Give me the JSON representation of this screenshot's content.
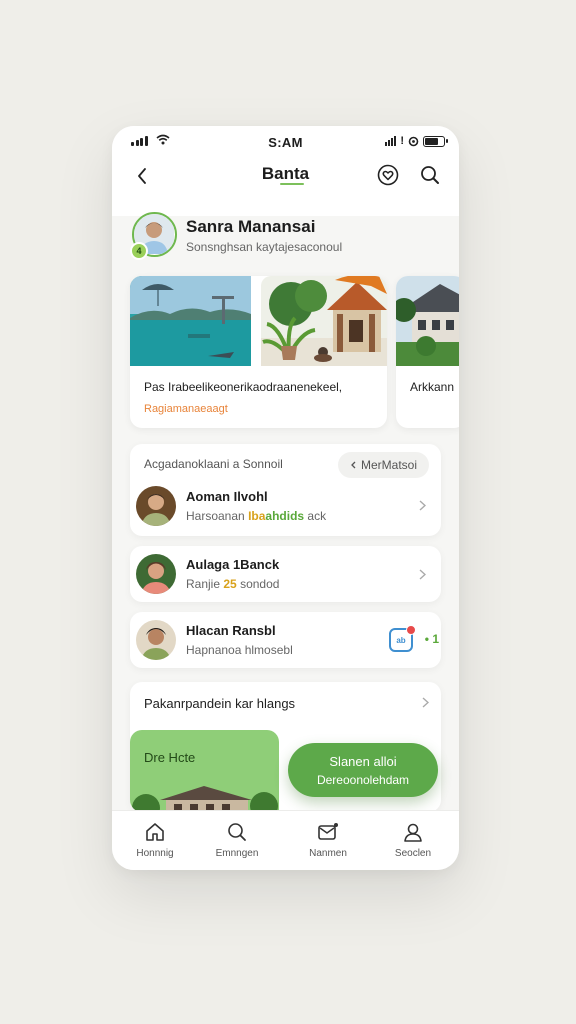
{
  "status_bar": {
    "time": "S:AM",
    "right_text": "!"
  },
  "header": {
    "title": "Banta",
    "back_icon": "chevron-left-icon",
    "actions": [
      "heart-icon",
      "search-icon"
    ]
  },
  "profile": {
    "name": "Sanra Manansai",
    "handle": "Sonsnghsan kaytajesaconoul",
    "badge": "4"
  },
  "carousel": {
    "cards": [
      {
        "caption": "Pas Irabeelikeonerikaodraanenekeel,",
        "sub": "Ragiamanaeaagt",
        "image": "lake-scene"
      },
      {
        "caption": "",
        "sub": "",
        "image": "tropical-house"
      },
      {
        "caption": "Arkkann",
        "sub": "",
        "image": "colonial-house"
      }
    ]
  },
  "suggestions": {
    "heading": "Acgadanoklaani a Sonnoil",
    "more_label": "MerMatsoi"
  },
  "contacts": [
    {
      "name": "Aoman Ilvohl",
      "desc": "Harsoanan",
      "tag": "Iba",
      "tag2": "ahdids",
      "tail": "ack"
    },
    {
      "name": "Aulaga 1Banck",
      "desc": "Ranjie",
      "tag": "25",
      "tag2": "",
      "tail": "sondod"
    },
    {
      "name": "Hlacan Ransbl",
      "desc": "Hapnanoa hlmosebl",
      "app_label": "ab",
      "mini": "• 1"
    }
  ],
  "promo": {
    "title": "Pakanrpandein kar hlangs",
    "green_title": "Dre Hcte"
  },
  "cta": {
    "line1": "Slanen alloi",
    "line2": "Dereoonolehdam"
  },
  "tabbar": [
    {
      "label": "Honnnig",
      "icon": "home-icon"
    },
    {
      "label": "Emnngen",
      "icon": "search-icon"
    },
    {
      "label": "Nanmen",
      "icon": "mail-icon"
    },
    {
      "label": "Seoclen",
      "icon": "profile-icon"
    }
  ],
  "colors": {
    "accent": "#5da94a",
    "highlight": "#e8843a",
    "background": "#efeee9"
  }
}
